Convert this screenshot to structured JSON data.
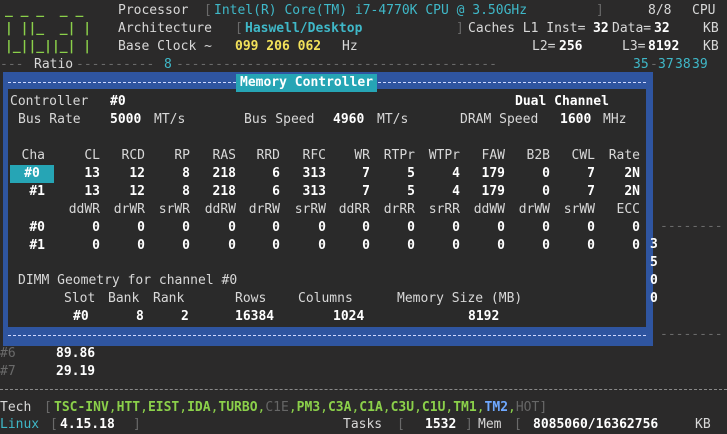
{
  "logo": [
    "_ _ _  _ _",
    "| ||_  _| |",
    "|_||_||_| |"
  ],
  "header": {
    "processor_label": "Processor",
    "processor_value": "Intel(R) Core(TM) i7-4770K CPU @ 3.50GHz",
    "cpu_count": "8/8",
    "cpu_label": "CPU",
    "arch_label": "Architecture",
    "arch_value": "Haswell/Desktop",
    "caches_label": "Caches L1 Inst=",
    "l1_inst": "32",
    "data_label": "Data=",
    "l1_data": "32",
    "kb": "KB",
    "base_clock_label": "Base Clock ~",
    "base_clock_value": "099 206 062",
    "hz": "Hz",
    "l2_label": "L2=",
    "l2_value": "256",
    "l3_label": "L3=",
    "l3_value": "8192",
    "ratio_label": "Ratio",
    "ratio_mark": "8",
    "ratio_right": "35",
    "ratio_right2": "37",
    "ratio_right3": "38",
    "ratio_right4": "39"
  },
  "panel": {
    "title": "Memory Controller",
    "controller_label": "Controller",
    "controller_value": "#0",
    "channel_mode": "Dual Channel",
    "bus_rate_label": "Bus Rate",
    "bus_rate_value": "5000",
    "bus_rate_unit": "MT/s",
    "bus_speed_label": "Bus Speed",
    "bus_speed_value": "4960",
    "bus_speed_unit": "MT/s",
    "dram_speed_label": "DRAM Speed",
    "dram_speed_value": "1600",
    "dram_speed_unit": "MHz",
    "timing_headers": [
      "Cha",
      "CL",
      "RCD",
      "RP",
      "RAS",
      "RRD",
      "RFC",
      "WR",
      "RTPr",
      "WTPr",
      "FAW",
      "B2B",
      "CWL",
      "Rate"
    ],
    "timing_rows": [
      [
        "#0",
        "13",
        "12",
        "8",
        "218",
        "6",
        "313",
        "7",
        "5",
        "4",
        "179",
        "0",
        "7",
        "2N"
      ],
      [
        "#1",
        "13",
        "12",
        "8",
        "218",
        "6",
        "313",
        "7",
        "5",
        "4",
        "179",
        "0",
        "7",
        "2N"
      ]
    ],
    "adv_headers": [
      "ddWR",
      "drWR",
      "srWR",
      "ddRW",
      "drRW",
      "srRW",
      "ddRR",
      "drRR",
      "srRR",
      "ddWW",
      "drWW",
      "srWW",
      "ECC"
    ],
    "adv_rows": [
      [
        "#0",
        "0",
        "0",
        "0",
        "0",
        "0",
        "0",
        "0",
        "0",
        "0",
        "0",
        "0",
        "0",
        "0"
      ],
      [
        "#1",
        "0",
        "0",
        "0",
        "0",
        "0",
        "0",
        "0",
        "0",
        "0",
        "0",
        "0",
        "0",
        "0"
      ]
    ],
    "dimm_title": "DIMM Geometry for channel #0",
    "dimm_headers": [
      "Slot",
      "Bank",
      "Rank",
      "Rows",
      "Columns",
      "Memory Size (MB)"
    ],
    "dimm_row": [
      "#0",
      "8",
      "2",
      "16384",
      "1024",
      "8192"
    ]
  },
  "right_digits": [
    "3",
    "5",
    "0",
    "0"
  ],
  "cores": [
    {
      "id": "#6",
      "freq": "89.86"
    },
    {
      "id": "#7",
      "freq": "29.19"
    }
  ],
  "footer": {
    "tech_label": "Tech",
    "tech_items": [
      {
        "label": "TSC-INV",
        "state": "on"
      },
      {
        "label": "HTT",
        "state": "on"
      },
      {
        "label": "EIST",
        "state": "on"
      },
      {
        "label": "IDA",
        "state": "on"
      },
      {
        "label": "TURBO",
        "state": "on"
      },
      {
        "label": "C1E",
        "state": "off"
      },
      {
        "label": "PM3",
        "state": "on"
      },
      {
        "label": "C3A",
        "state": "on"
      },
      {
        "label": "C1A",
        "state": "on"
      },
      {
        "label": "C3U",
        "state": "on"
      },
      {
        "label": "C1U",
        "state": "on"
      },
      {
        "label": "TM1",
        "state": "on"
      },
      {
        "label": "TM2",
        "state": "blue"
      },
      {
        "label": "HOT",
        "state": "off"
      }
    ],
    "os_label": "Linux",
    "os_version": "4.15.18",
    "tasks_label": "Tasks",
    "tasks_value": "1532",
    "mem_label": "Mem",
    "mem_value": "8085060/16362756",
    "mem_unit": "KB"
  },
  "colors": {
    "background": "#2b2a2a",
    "panel_border": "#2f55a0",
    "title_bg": "#26a5b5",
    "green": "#8bd04a",
    "yellow": "#f2e15a",
    "cyan": "#3fb8c8"
  }
}
